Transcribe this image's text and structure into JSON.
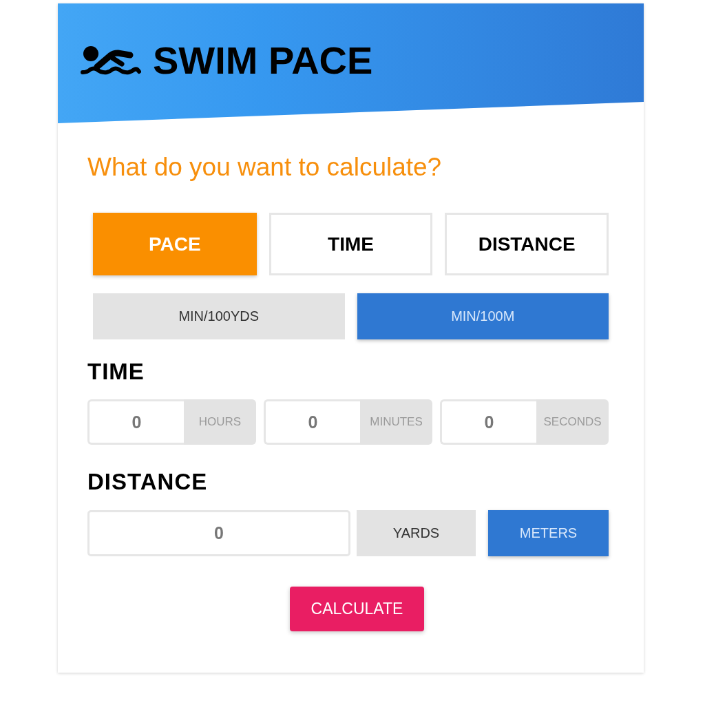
{
  "header": {
    "title": "SWIM PACE"
  },
  "question": "What do you want to calculate?",
  "modes": [
    {
      "label": "PACE",
      "selected": true
    },
    {
      "label": "TIME",
      "selected": false
    },
    {
      "label": "DISTANCE",
      "selected": false
    }
  ],
  "pace_units": [
    {
      "label": "MIN/100YDS",
      "selected": false
    },
    {
      "label": "MIN/100M",
      "selected": true
    }
  ],
  "time": {
    "label": "TIME",
    "fields": [
      {
        "value": "0",
        "unit": "HOURS"
      },
      {
        "value": "0",
        "unit": "MINUTES"
      },
      {
        "value": "0",
        "unit": "SECONDS"
      }
    ]
  },
  "distance": {
    "label": "DISTANCE",
    "value": "0",
    "units": [
      {
        "label": "YARDS",
        "selected": false
      },
      {
        "label": "METERS",
        "selected": true
      }
    ]
  },
  "calculate_button": "CALCULATE"
}
